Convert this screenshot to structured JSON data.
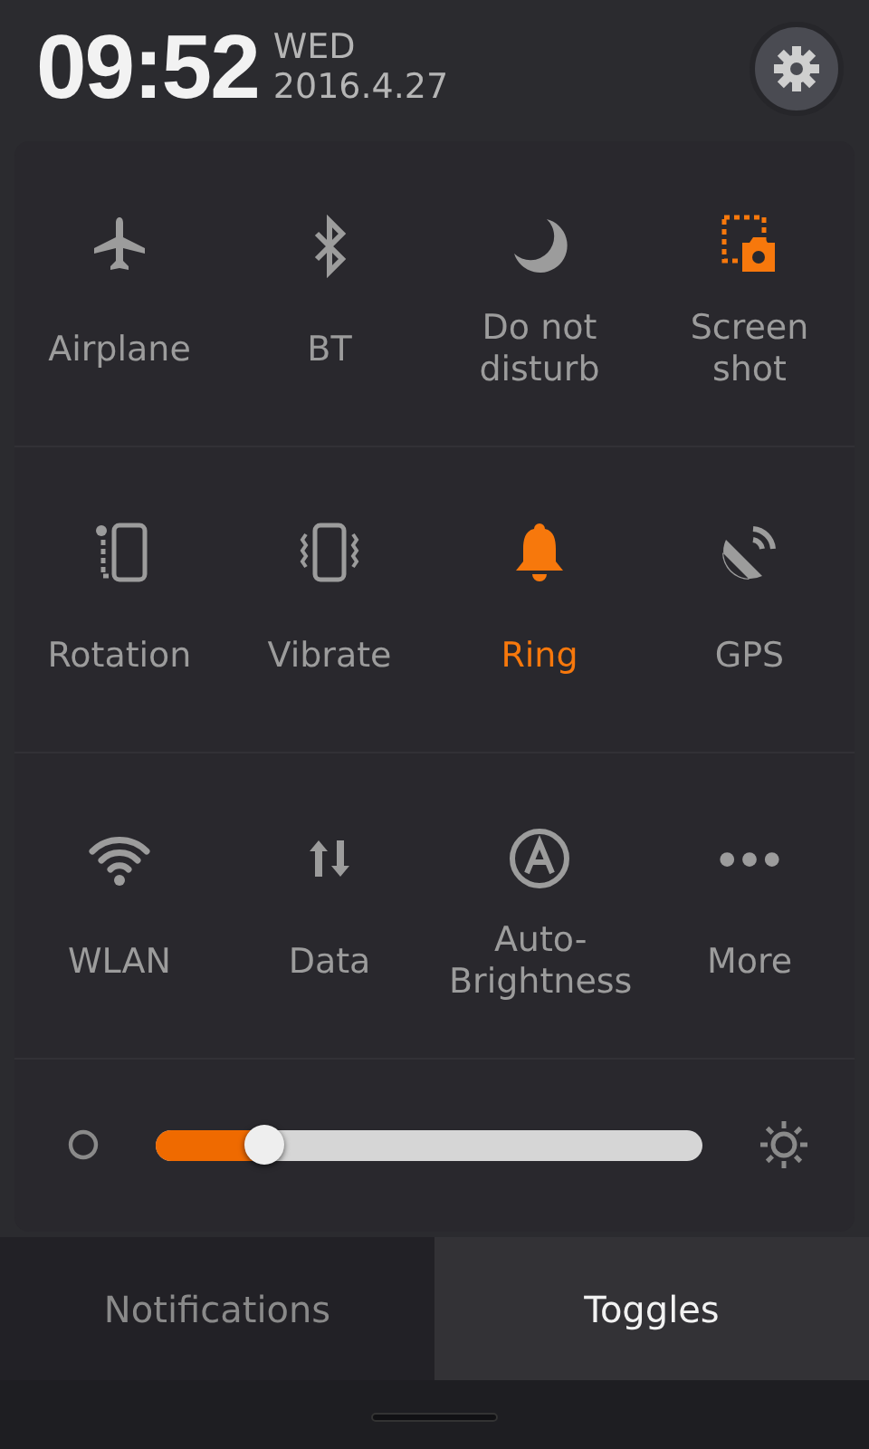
{
  "header": {
    "time": "09:52",
    "weekday": "WED",
    "date": "2016.4.27"
  },
  "toggles": [
    {
      "label": "Airplane",
      "kind": "airplane",
      "on": false
    },
    {
      "label": "BT",
      "kind": "bluetooth",
      "on": false
    },
    {
      "label": "Do not disturb",
      "kind": "moon",
      "on": false
    },
    {
      "label": "Screen shot",
      "kind": "screenshot",
      "on": false
    },
    {
      "label": "Rotation",
      "kind": "rotation",
      "on": false
    },
    {
      "label": "Vibrate",
      "kind": "vibrate",
      "on": false
    },
    {
      "label": "Ring",
      "kind": "bell",
      "on": true
    },
    {
      "label": "GPS",
      "kind": "gps",
      "on": false
    },
    {
      "label": "WLAN",
      "kind": "wifi",
      "on": false
    },
    {
      "label": "Data",
      "kind": "data",
      "on": false
    },
    {
      "label": "Auto-Brightness",
      "kind": "auto",
      "on": false
    },
    {
      "label": "More",
      "kind": "more",
      "on": false
    }
  ],
  "brightness": {
    "level": 0.2
  },
  "tabs": [
    {
      "label": "Notifications",
      "selected": false
    },
    {
      "label": "Toggles",
      "selected": true
    }
  ]
}
